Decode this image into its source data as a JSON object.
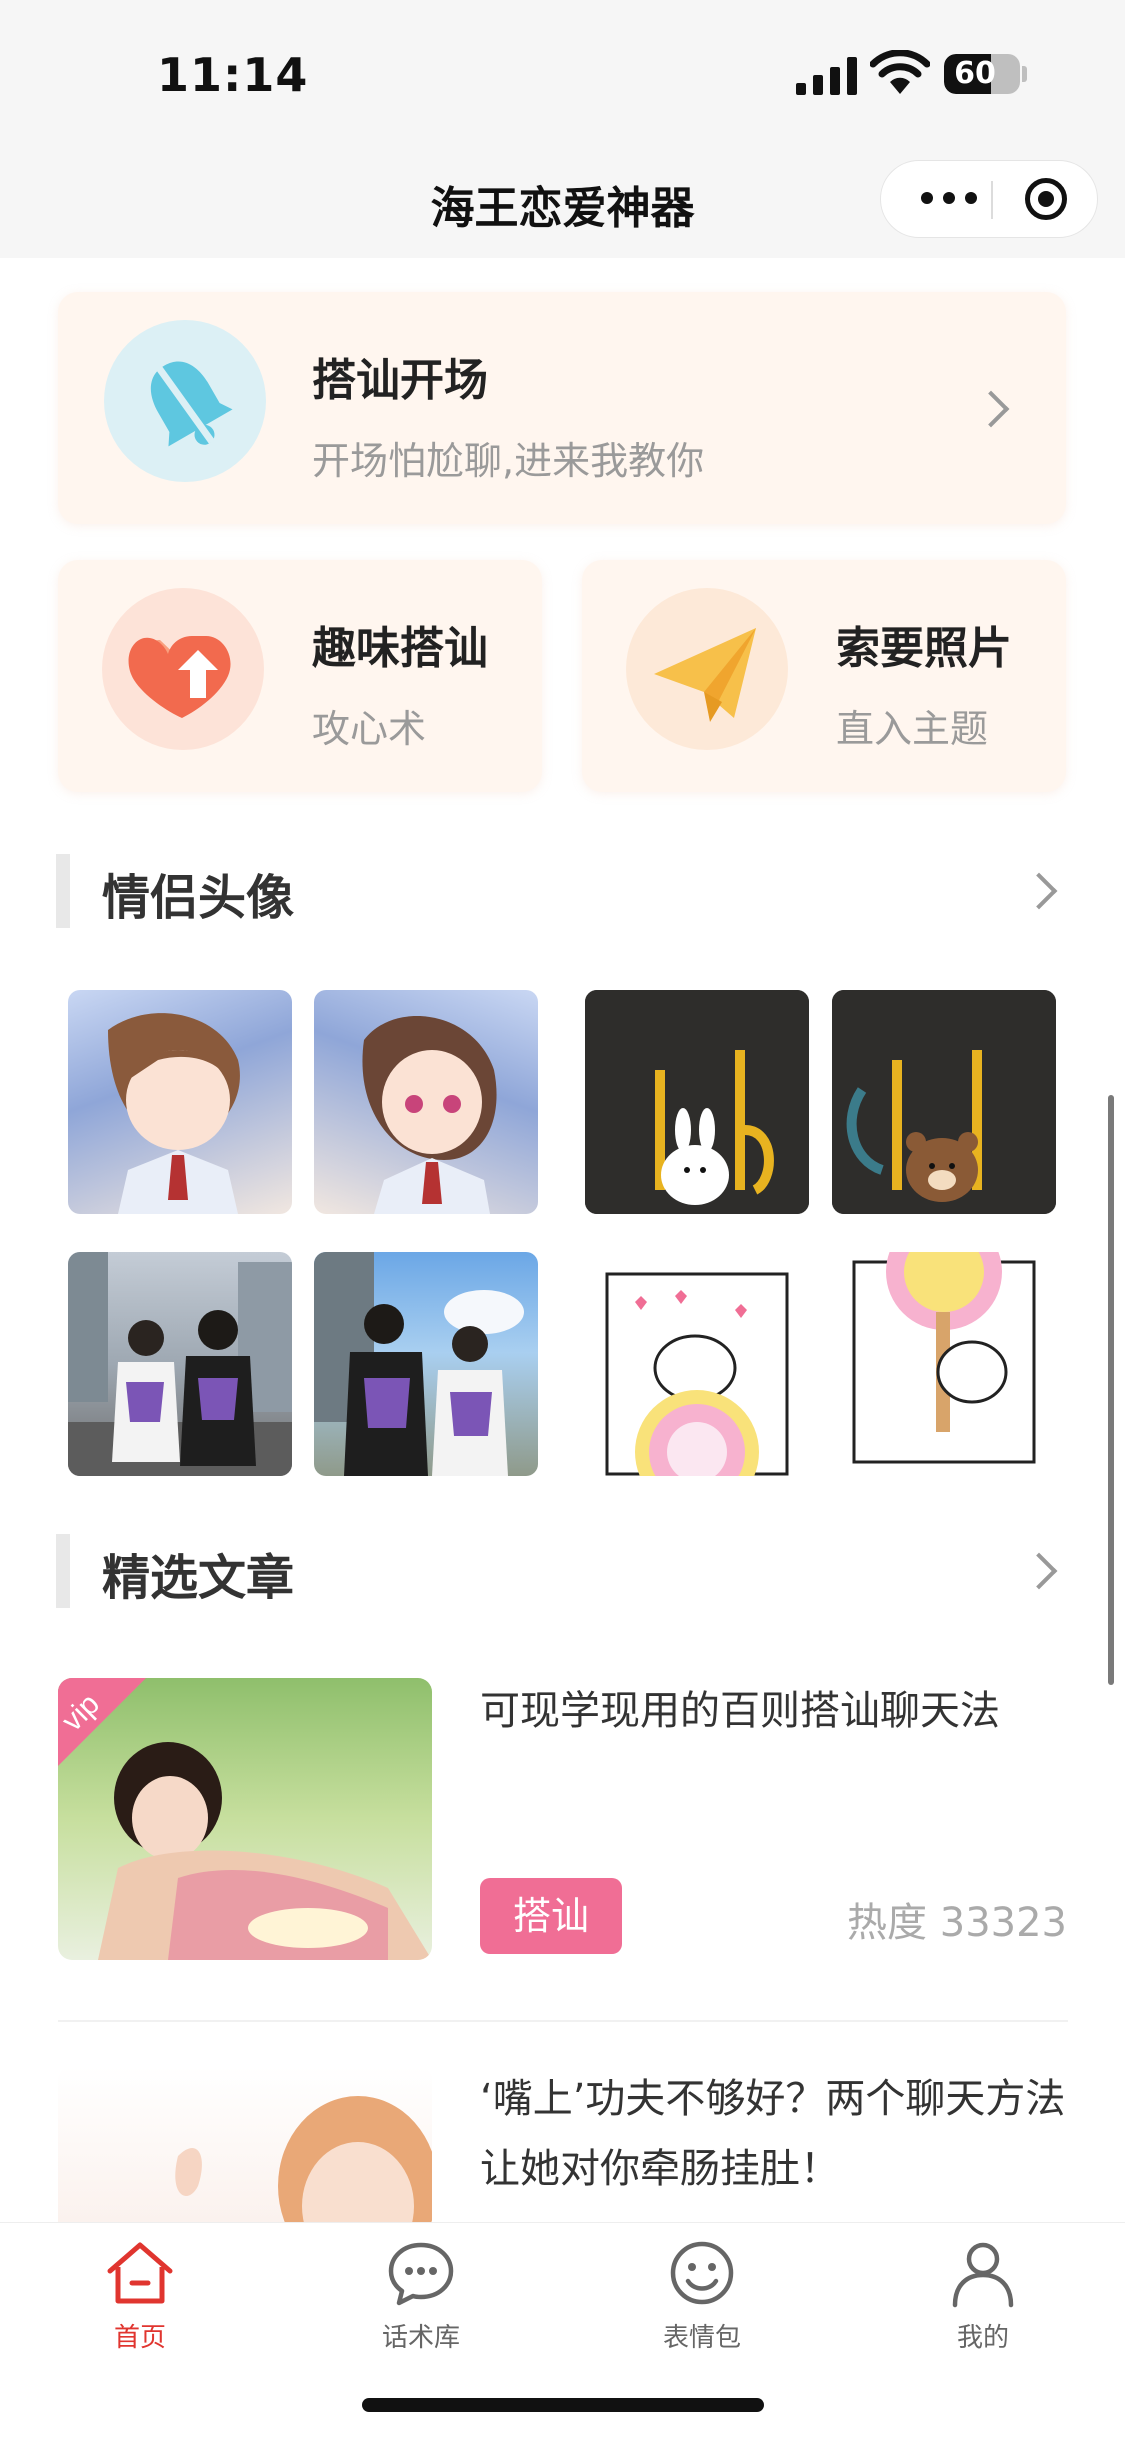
{
  "status_bar": {
    "time": "11:14",
    "battery": "60",
    "battery_level": 0.6
  },
  "nav": {
    "title": "海王恋爱神器"
  },
  "cards": {
    "opening": {
      "title": "搭讪开场",
      "subtitle": "开场怕尬聊,进来我教你"
    },
    "fun": {
      "title": "趣味搭讪",
      "subtitle": "攻心术"
    },
    "photo": {
      "title": "索要照片",
      "subtitle": "直入主题"
    }
  },
  "sections": {
    "avatars": {
      "title": "情侣头像"
    },
    "articles": {
      "title": "精选文章"
    }
  },
  "articles": [
    {
      "title": "可现学现用的百则搭讪聊天法",
      "tag": "搭讪",
      "heat": "热度 33323",
      "badge": "vip"
    },
    {
      "title": "‘嘴上’功夫不够好？两个聊天方法让她对你牵肠挂肚！"
    }
  ],
  "tabs": [
    {
      "label": "首页",
      "icon": "home-icon",
      "active": true
    },
    {
      "label": "话术库",
      "icon": "chat-bubble-icon",
      "active": false
    },
    {
      "label": "表情包",
      "icon": "smiley-icon",
      "active": false
    },
    {
      "label": "我的",
      "icon": "person-icon",
      "active": false
    }
  ],
  "colors": {
    "accent": "#e0352f",
    "tag": "#f06e95",
    "card_bg": "#fff6ef"
  }
}
